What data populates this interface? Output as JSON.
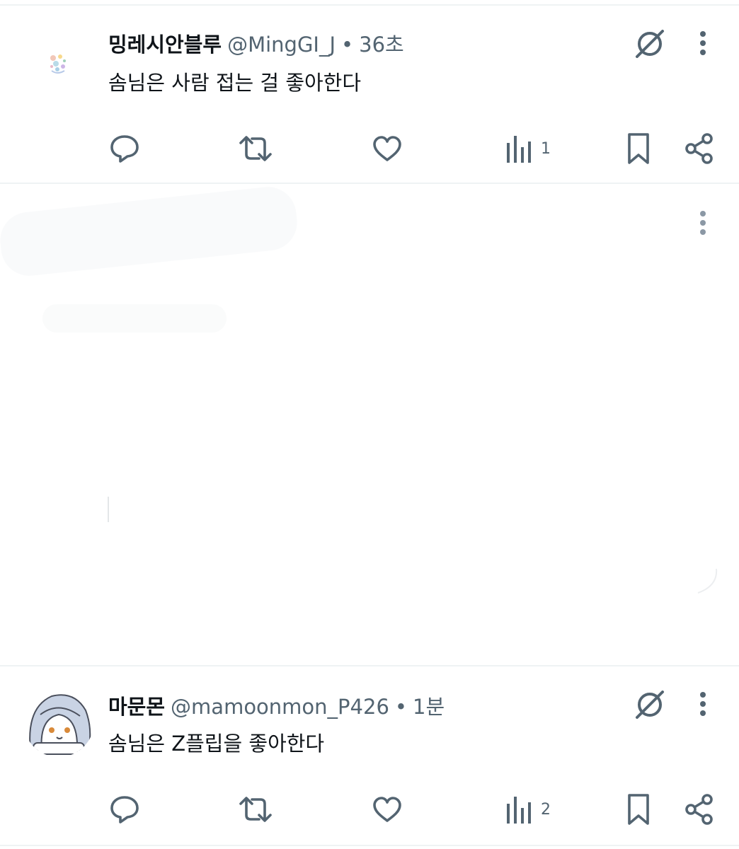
{
  "tweets": [
    {
      "name": "밍레시안블루",
      "handle": "@MingGI_J",
      "separator": "•",
      "time": "36초",
      "text": "솜님은 사람 접는 걸 좋아한다",
      "views": "1",
      "icons": [
        "no-grok-icon",
        "more-icon",
        "reply-icon",
        "retweet-icon",
        "like-icon",
        "views-icon",
        "bookmark-icon",
        "share-icon"
      ]
    },
    {
      "name": "마문몬",
      "handle": "@mamoonmon_P426",
      "separator": "•",
      "time": "1분",
      "text": "솜님은 Z플립을 좋아한다",
      "views": "2",
      "icons": [
        "no-grok-icon",
        "more-icon",
        "reply-icon",
        "retweet-icon",
        "like-icon",
        "views-icon",
        "bookmark-icon",
        "share-icon"
      ]
    }
  ],
  "colors": {
    "text": "#0f1419",
    "secondary": "#536471",
    "divider": "#eff3f4",
    "background": "#ffffff"
  }
}
